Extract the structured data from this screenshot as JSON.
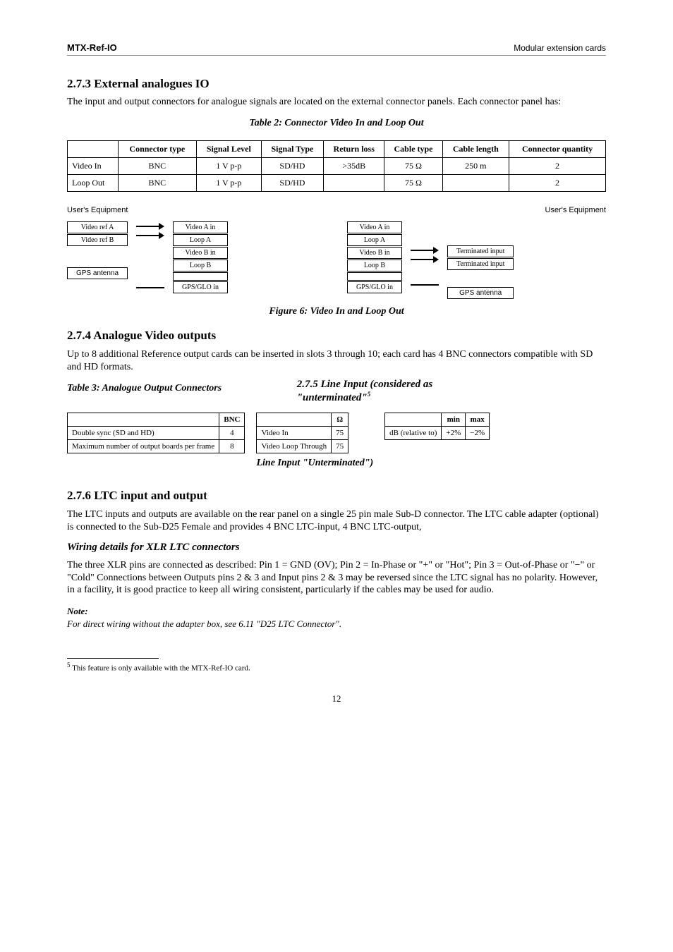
{
  "header": {
    "left": "MTX-Ref-IO",
    "right": "Modular extension cards"
  },
  "sections": {
    "ext_io_title": "2.7.3 External analogues IO",
    "ext_io_lead": "The input and output connectors for analogue signals are located on the external connector panels. Each connector panel has:",
    "table1_caption": "Table 2: Connector Video In and Loop Out",
    "diagram_caption": "Figure 6: Video In and Loop Out",
    "user_eq": "User's Equipment",
    "analogue_out_title": "2.7.4 Analogue Video outputs",
    "analogue_out_lead": "Up to 8 additional Reference output cards can be inserted in slots 3 through 10; each card has 4 BNC connectors compatible with SD and HD formats.",
    "line_input_title": "2.7.5 Line Input (considered as \"unterminated\"",
    "line_input_sub": "Line Input \"Unterminated\")",
    "ltc_title": "2.7.6 LTC input and output",
    "ltc_body": "The LTC inputs and outputs are available on the rear panel on a single 25 pin male Sub-D connector. The LTC cable adapter (optional) is connected to the Sub-D25 Female and provides 4 BNC LTC-input, 4 BNC LTC-output,",
    "wiring_title": "Wiring details for XLR LTC connectors",
    "wiring_body": "The three XLR pins are connected as described: Pin 1 = GND (OV); Pin 2 = In-Phase or \"+\" or \"Hot\"; Pin 3 = Out-of-Phase or \"−\" or \"Cold\" Connections between Outputs pins 2 & 3 and Input pins 2 & 3 may be reversed since the LTC signal has no polarity. However, in a facility, it is good practice to keep all wiring consistent, particularly if the cables may be used for audio.",
    "note_head": "Note:",
    "note_body": "For direct wiring without the adapter box, see 6.11 \"D25 LTC Connector\".",
    "footnote": "This feature is only available with the MTX-Ref-IO card.",
    "footnote_ref": "5",
    "pagenum": "12"
  },
  "table1": {
    "headers": [
      "",
      "Connector type",
      "Signal Level",
      "Signal Type",
      "Return loss",
      "Cable type",
      "Cable length",
      "Connector quantity"
    ],
    "rows": [
      [
        "Video In",
        "BNC",
        "1 V p-p",
        "SD/HD",
        ">35dB",
        "75 Ω",
        "250 m",
        "2"
      ],
      [
        "Loop Out",
        "BNC",
        "1 V p-p",
        "SD/HD",
        "",
        "75 Ω",
        "",
        "2"
      ]
    ]
  },
  "diagram": {
    "left": {
      "src1": "Video ref A",
      "src2": "Video ref B",
      "card": [
        "Video A in",
        "Loop A",
        "Video B in",
        "Loop B",
        "",
        "GPS/GLO in"
      ],
      "bottom": "GPS antenna"
    },
    "right": {
      "card": [
        "Video A in",
        "Loop A",
        "Video B in",
        "Loop B",
        "",
        "GPS/GLO in"
      ],
      "dst1": "Terminated input",
      "dst2": "Terminated input",
      "bottom": "GPS antenna"
    }
  },
  "out_tables": {
    "t1_caption": "Table 3: Analogue Output Connectors",
    "t1": {
      "headers": [
        "",
        "BNC"
      ],
      "rows": [
        [
          "Double sync (SD and HD)",
          "4"
        ],
        [
          "Maximum number of output boards per frame",
          "8"
        ]
      ]
    },
    "t2": {
      "headers": [
        "",
        "Ω"
      ],
      "rows": [
        [
          "Video In",
          "75"
        ],
        [
          "Video Loop Through",
          "75"
        ]
      ]
    },
    "t3": {
      "headers": [
        "",
        "min",
        "max"
      ],
      "rows": [
        [
          "dB (relative to)",
          "+2%",
          "−2%"
        ]
      ]
    }
  }
}
